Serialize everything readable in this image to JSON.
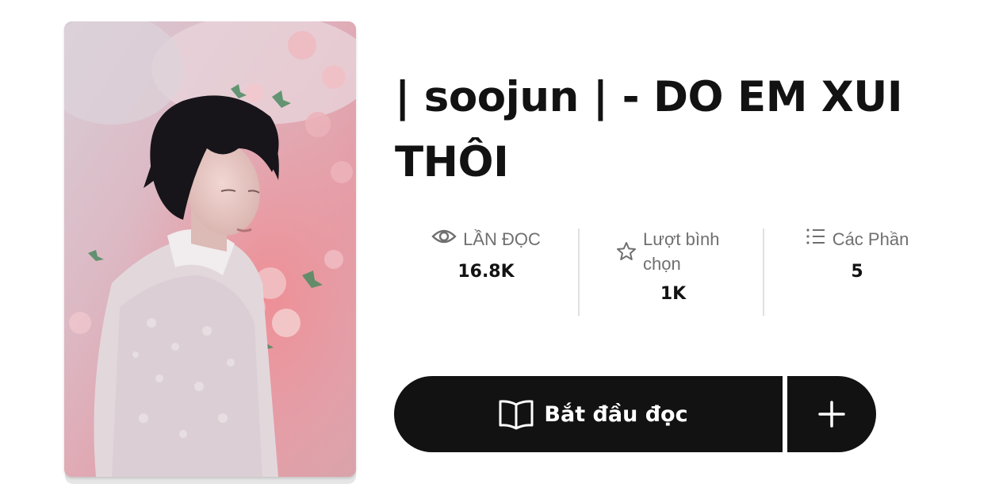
{
  "story": {
    "title": "| soojun | - DO EM XUI THÔI"
  },
  "stats": {
    "reads": {
      "icon": "eye-icon",
      "label": "LẦN ĐỌC",
      "value": "16.8K"
    },
    "votes": {
      "icon": "star-icon",
      "label": "Lượt bình chọn",
      "value": "1K"
    },
    "parts": {
      "icon": "list-icon",
      "label": "Các Phần",
      "value": "5"
    }
  },
  "actions": {
    "start_reading": {
      "icon": "open-book-icon",
      "label": "Bắt đầu đọc"
    },
    "add_to_list": {
      "icon": "plus-icon"
    }
  },
  "colors": {
    "button_bg": "#121212",
    "text_primary": "#121212",
    "text_muted": "#6f6f6f"
  }
}
